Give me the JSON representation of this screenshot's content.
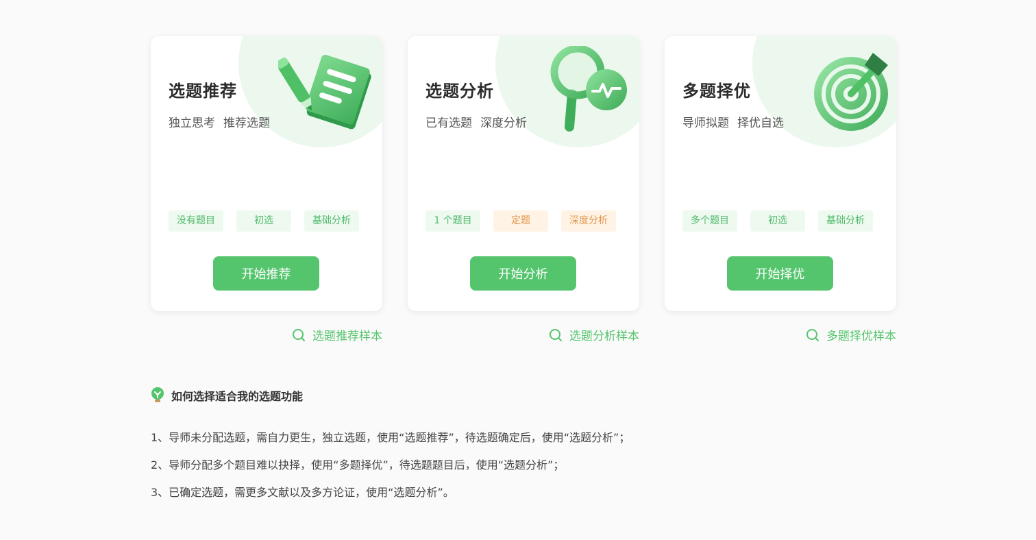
{
  "cards": [
    {
      "title": "选题推荐",
      "sub": [
        "独立思考",
        "推荐选题"
      ],
      "tags": [
        {
          "label": "没有题目",
          "color": "green"
        },
        {
          "label": "初选",
          "color": "green"
        },
        {
          "label": "基础分析",
          "color": "green"
        }
      ],
      "button": "开始推荐",
      "sample": "选题推荐样本",
      "illustration": "pencil-notebook-icon"
    },
    {
      "title": "选题分析",
      "sub": [
        "已有选题",
        "深度分析"
      ],
      "tags": [
        {
          "label": "1 个题目",
          "color": "green"
        },
        {
          "label": "定题",
          "color": "orange"
        },
        {
          "label": "深度分析",
          "color": "orange"
        }
      ],
      "button": "开始分析",
      "sample": "选题分析样本",
      "illustration": "magnifier-pulse-icon"
    },
    {
      "title": "多题择优",
      "sub": [
        "导师拟题",
        "择优自选"
      ],
      "tags": [
        {
          "label": "多个题目",
          "color": "green"
        },
        {
          "label": "初选",
          "color": "green"
        },
        {
          "label": "基础分析",
          "color": "green"
        }
      ],
      "button": "开始择优",
      "sample": "多题择优样本",
      "illustration": "target-dart-icon"
    }
  ],
  "help": {
    "title": "如何选择适合我的选题功能",
    "icon": "lightbulb-icon",
    "items": [
      "1、导师未分配选题，需自力更生，独立选题，使用“选题推荐”，待选题确定后，使用“选题分析”；",
      "2、导师分配多个题目难以抉择，使用“多题择优”，待选题题目后，使用“选题分析”；",
      "3、已确定选题，需更多文献以及多方论证，使用“选题分析”。"
    ]
  },
  "colors": {
    "accent": "#55c56d",
    "tag_green_bg": "#eef9f0",
    "tag_orange_bg": "#fff3e6",
    "tag_orange_text": "#e3974d"
  }
}
